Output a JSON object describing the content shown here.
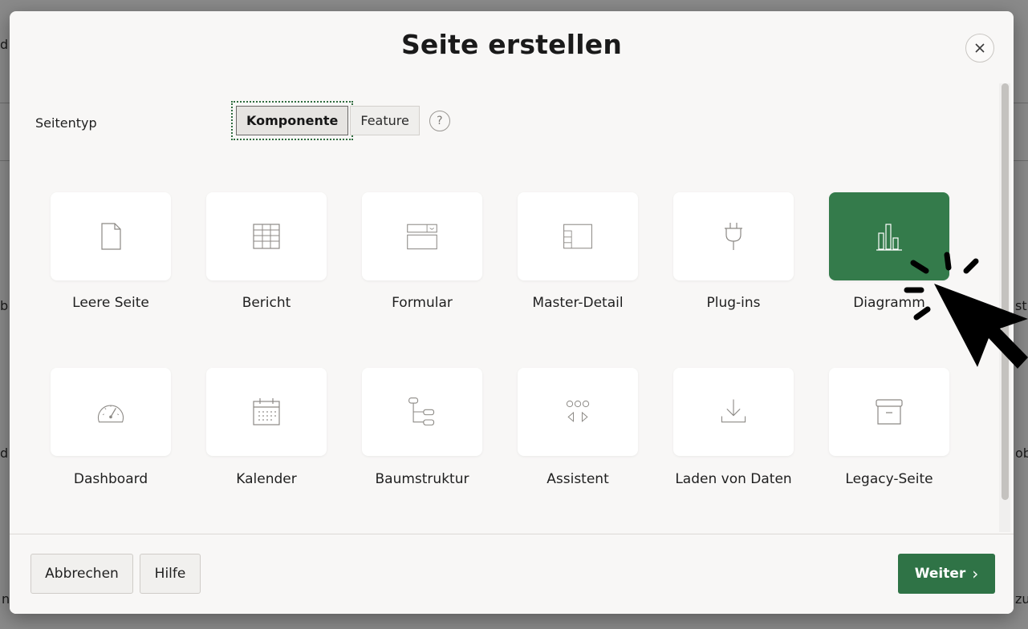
{
  "dialog": {
    "title": "Seite erstellen",
    "page_type_label": "Seitentyp",
    "segments": [
      {
        "label": "Komponente",
        "selected": true
      },
      {
        "label": "Feature",
        "selected": false
      }
    ],
    "help_symbol": "?"
  },
  "tiles": [
    {
      "label": "Leere Seite",
      "icon": "blank-page-icon",
      "selected": false
    },
    {
      "label": "Bericht",
      "icon": "report-grid-icon",
      "selected": false
    },
    {
      "label": "Formular",
      "icon": "form-icon",
      "selected": false
    },
    {
      "label": "Master-Detail",
      "icon": "master-detail-icon",
      "selected": false
    },
    {
      "label": "Plug-ins",
      "icon": "plug-icon",
      "selected": false
    },
    {
      "label": "Diagramm",
      "icon": "bar-chart-icon",
      "selected": true
    },
    {
      "label": "Dashboard",
      "icon": "gauge-icon",
      "selected": false
    },
    {
      "label": "Kalender",
      "icon": "calendar-icon",
      "selected": false
    },
    {
      "label": "Baumstruktur",
      "icon": "tree-icon",
      "selected": false
    },
    {
      "label": "Assistent",
      "icon": "wizard-icon",
      "selected": false
    },
    {
      "label": "Laden von Daten",
      "icon": "download-icon",
      "selected": false
    },
    {
      "label": "Legacy-Seite",
      "icon": "archive-icon",
      "selected": false
    }
  ],
  "footer": {
    "cancel_label": "Abbrechen",
    "help_label": "Hilfe",
    "next_label": "Weiter",
    "next_arrow": "›"
  },
  "background": {
    "fragments": [
      "d",
      "b",
      "d",
      "n",
      "st",
      "ob",
      "zu"
    ]
  },
  "colors": {
    "primary": "#2f7346",
    "selected_tile": "#347b4b"
  }
}
